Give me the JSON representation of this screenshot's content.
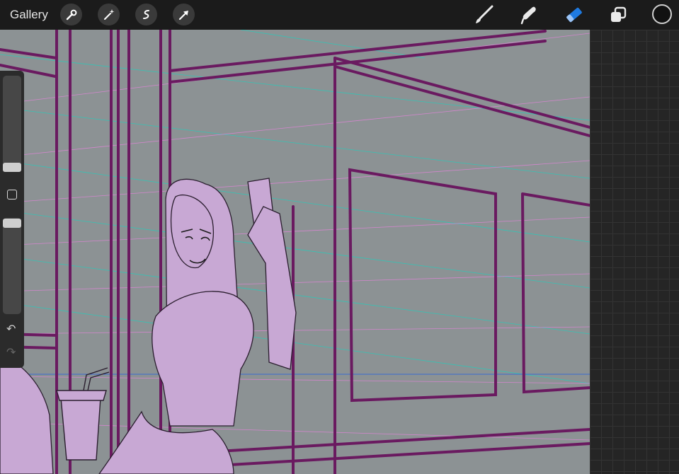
{
  "topbar": {
    "gallery_label": "Gallery",
    "left_tools": [
      "wrench-icon",
      "magic-wand-icon",
      "selection-icon",
      "transform-arrow-icon"
    ],
    "right_tools": [
      "brush-icon",
      "smudge-icon",
      "eraser-icon",
      "layers-icon"
    ],
    "active_tool": "eraser-icon",
    "active_color": "#111111",
    "accent_color": "#1f7ae0"
  },
  "sidebar": {
    "controls": [
      "brush-size-slider",
      "modify-button",
      "opacity-slider",
      "undo-icon",
      "redo-icon"
    ]
  },
  "canvas": {
    "background_color": "#8c9294",
    "line_color": "#6a1a60",
    "figure_fill": "#c8a8d4",
    "guide_colors": [
      "#2cc8b8",
      "#e084d8",
      "#3a6ad0"
    ]
  }
}
